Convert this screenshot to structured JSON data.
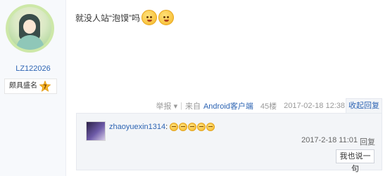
{
  "author": {
    "username": "LZ122026",
    "badge_label": "颇具盛名",
    "badge_level": "7"
  },
  "post": {
    "text": "就没人站“泡馍”吗",
    "emojis": [
      "confused-face",
      "confused-face"
    ]
  },
  "tail": {
    "report": "举报",
    "report_arrow": "▾",
    "separator": "|",
    "source_prefix": "来自",
    "source_client": "Android客户端",
    "floor": "45楼",
    "timestamp": "2017-02-18 12:38",
    "collapse": "收起回复"
  },
  "reply": {
    "username": "zhaoyuexin1314",
    "colon": ":",
    "emojis": [
      "laughing-face",
      "laughing-face",
      "laughing-face",
      "laughing-face",
      "laughing-face"
    ],
    "time": "2017-2-18 11:01",
    "reply_link": "回复",
    "say_button": "我也说一句"
  },
  "colors": {
    "link": "#2d64b3",
    "sidebar_bg": "#f7f9fc",
    "reply_bg": "#f3f5f8"
  }
}
